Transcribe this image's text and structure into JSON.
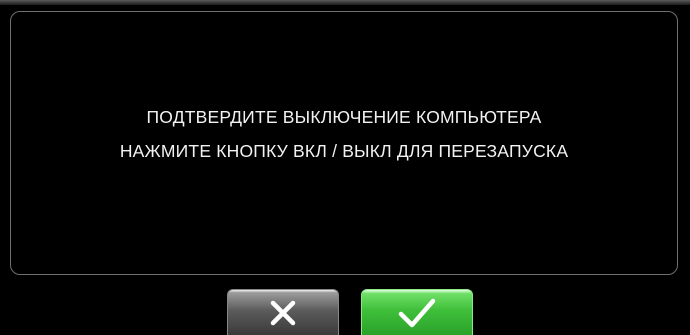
{
  "dialog": {
    "message_lines": [
      "ПОДТВЕРДИТЕ ВЫКЛЮЧЕНИЕ КОМПЬЮТЕРА",
      "НАЖМИТЕ КНОПКУ ВКЛ / ВЫКЛ ДЛЯ ПЕРЕЗАПУСКА"
    ]
  },
  "buttons": {
    "cancel": {
      "icon": "close-icon",
      "color": "#4a4a4a"
    },
    "confirm": {
      "icon": "checkmark-icon",
      "color": "#3fbf3a"
    }
  },
  "colors": {
    "background": "#000000",
    "text": "#f2f2f2",
    "panel_border": "#6f6f6f"
  }
}
